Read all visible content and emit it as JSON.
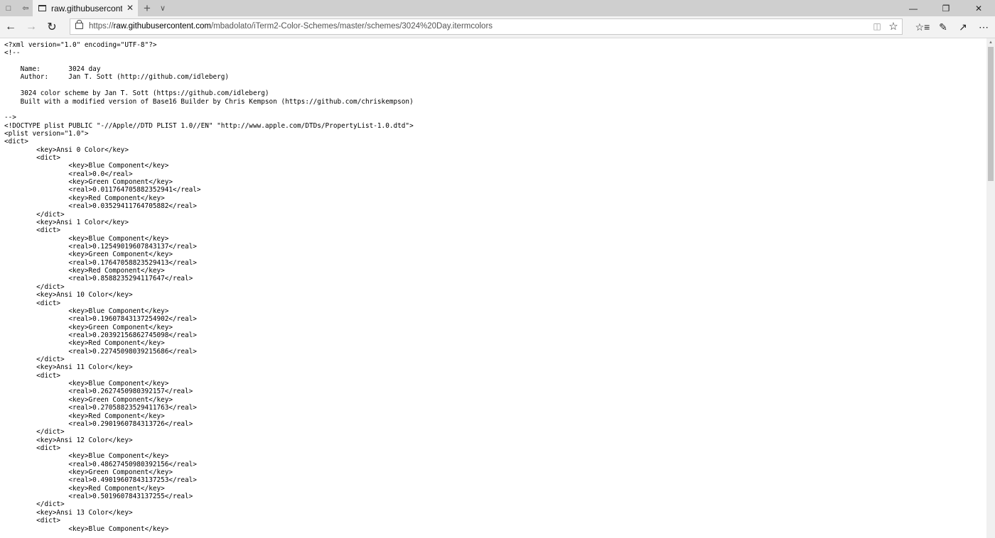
{
  "browser": {
    "tab": {
      "title": "raw.githubusercontent.c"
    },
    "address": {
      "scheme": "https://",
      "host": "raw.githubusercontent.com",
      "path": "/mbadolato/iTerm2-Color-Schemes/master/schemes/3024%20Day.itermcolors"
    },
    "icons": {
      "tab_actions": "tab-actions-icon",
      "set_aside": "set-aside-tabs-icon",
      "back": "arrow-left-icon",
      "forward": "arrow-right-icon",
      "refresh": "refresh-icon",
      "lock": "lock-icon",
      "reading_view": "book-icon",
      "favorite": "star-icon",
      "favorites_hub": "favorites-list-icon",
      "notes": "pen-icon",
      "share": "share-icon",
      "more": "ellipsis-icon",
      "minimize": "minimize-icon",
      "maximize": "restore-icon",
      "close": "close-icon"
    }
  },
  "document": {
    "lines": [
      "<?xml version=\"1.0\" encoding=\"UTF-8\"?>",
      "<!--",
      "",
      "    Name:       3024 day",
      "    Author:     Jan T. Sott (http://github.com/idleberg)",
      "",
      "    3024 color scheme by Jan T. Sott (https://github.com/idleberg)",
      "    Built with a modified version of Base16 Builder by Chris Kempson (https://github.com/chriskempson)",
      "",
      "-->",
      "<!DOCTYPE plist PUBLIC \"-//Apple//DTD PLIST 1.0//EN\" \"http://www.apple.com/DTDs/PropertyList-1.0.dtd\">",
      "<plist version=\"1.0\">",
      "<dict>",
      "\t<key>Ansi 0 Color</key>",
      "\t<dict>",
      "\t\t<key>Blue Component</key>",
      "\t\t<real>0.0</real>",
      "\t\t<key>Green Component</key>",
      "\t\t<real>0.011764705882352941</real>",
      "\t\t<key>Red Component</key>",
      "\t\t<real>0.03529411764705882</real>",
      "\t</dict>",
      "\t<key>Ansi 1 Color</key>",
      "\t<dict>",
      "\t\t<key>Blue Component</key>",
      "\t\t<real>0.12549019607843137</real>",
      "\t\t<key>Green Component</key>",
      "\t\t<real>0.17647058823529413</real>",
      "\t\t<key>Red Component</key>",
      "\t\t<real>0.8588235294117647</real>",
      "\t</dict>",
      "\t<key>Ansi 10 Color</key>",
      "\t<dict>",
      "\t\t<key>Blue Component</key>",
      "\t\t<real>0.19607843137254902</real>",
      "\t\t<key>Green Component</key>",
      "\t\t<real>0.20392156862745098</real>",
      "\t\t<key>Red Component</key>",
      "\t\t<real>0.22745098039215686</real>",
      "\t</dict>",
      "\t<key>Ansi 11 Color</key>",
      "\t<dict>",
      "\t\t<key>Blue Component</key>",
      "\t\t<real>0.2627450980392157</real>",
      "\t\t<key>Green Component</key>",
      "\t\t<real>0.27058823529411763</real>",
      "\t\t<key>Red Component</key>",
      "\t\t<real>0.2901960784313726</real>",
      "\t</dict>",
      "\t<key>Ansi 12 Color</key>",
      "\t<dict>",
      "\t\t<key>Blue Component</key>",
      "\t\t<real>0.48627450980392156</real>",
      "\t\t<key>Green Component</key>",
      "\t\t<real>0.49019607843137253</real>",
      "\t\t<key>Red Component</key>",
      "\t\t<real>0.5019607843137255</real>",
      "\t</dict>",
      "\t<key>Ansi 13 Color</key>",
      "\t<dict>",
      "\t\t<key>Blue Component</key>"
    ]
  }
}
